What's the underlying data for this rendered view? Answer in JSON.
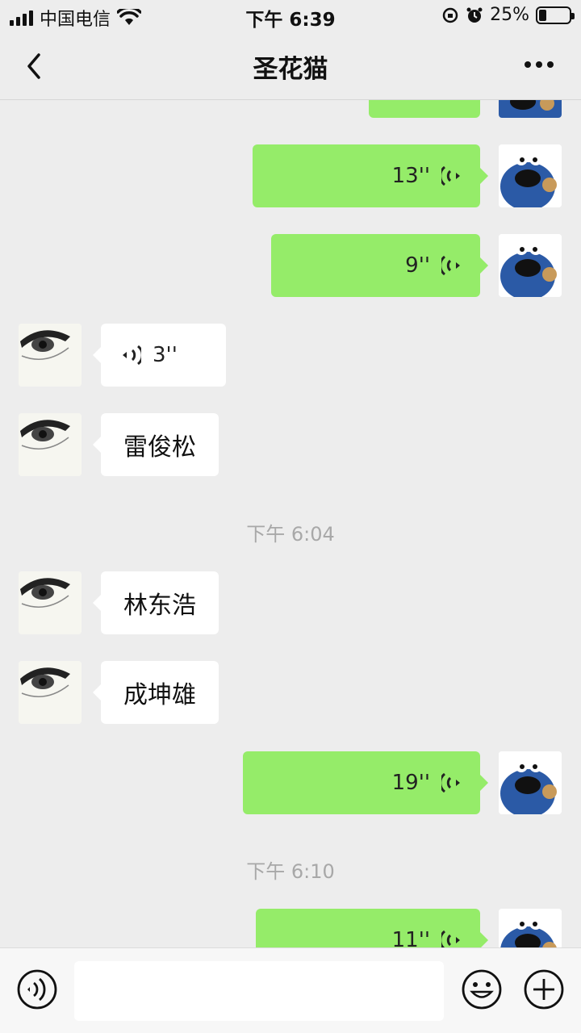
{
  "status_bar": {
    "carrier": "中国电信",
    "time": "下午 6:39",
    "battery": "25%",
    "battery_level": 0.25
  },
  "nav": {
    "title": "圣花猫",
    "back_icon": "chevron-left-icon",
    "more_icon": "more-dots-icon"
  },
  "messages": [
    {
      "type": "voice",
      "from": "me",
      "duration": "13''"
    },
    {
      "type": "voice",
      "from": "me",
      "duration": "9''"
    },
    {
      "type": "voice",
      "from": "them",
      "duration": "3''"
    },
    {
      "type": "text",
      "from": "them",
      "text": "雷俊松"
    },
    {
      "type": "time",
      "text": "下午 6:04"
    },
    {
      "type": "text",
      "from": "them",
      "text": "林东浩"
    },
    {
      "type": "text",
      "from": "them",
      "text": "成坤雄"
    },
    {
      "type": "voice",
      "from": "me",
      "duration": "19''"
    },
    {
      "type": "time",
      "text": "下午 6:10"
    },
    {
      "type": "voice",
      "from": "me",
      "duration": "11''"
    }
  ],
  "input_bar": {
    "voice_icon": "voice-mode-icon",
    "input_value": "",
    "emoji_icon": "emoji-icon",
    "plus_icon": "plus-icon"
  },
  "colors": {
    "background": "#ededed",
    "my_bubble": "#95ec69",
    "their_bubble": "#ffffff",
    "time_text": "#a8a8a8"
  }
}
